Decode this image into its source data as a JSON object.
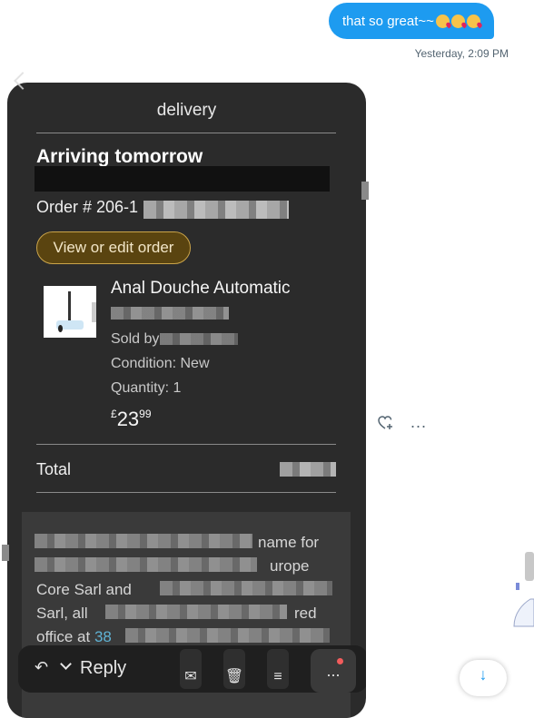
{
  "message": {
    "text": "that so great~~",
    "emoji": [
      "kissing-face-icon",
      "kissing-face-icon",
      "kissing-face-icon"
    ],
    "timestamp": "Yesterday, 2:09 PM"
  },
  "screenshot": {
    "header_title": "delivery",
    "heading": "Arriving tomorrow",
    "order_label": "Order # 206-1",
    "edit_button": "View or edit order",
    "product": {
      "name": "Anal Douche Automatic",
      "sold_by": "Sold by",
      "condition": "Condition: New",
      "quantity": "Quantity: 1",
      "price_currency": "£",
      "price_main": "23",
      "price_cents": "99"
    },
    "total_label": "Total",
    "legal": {
      "line1": "name for",
      "line2": "urope",
      "line3": "Core Sarl and",
      "line4": "Sarl, all",
      "line4b": "red",
      "line5": "office at",
      "line5_link": "38"
    },
    "toolbar": {
      "reply": "Reply",
      "more": "..."
    }
  },
  "actions": {
    "react": "heart-plus-icon",
    "more": "...",
    "scroll_down": "↓"
  }
}
